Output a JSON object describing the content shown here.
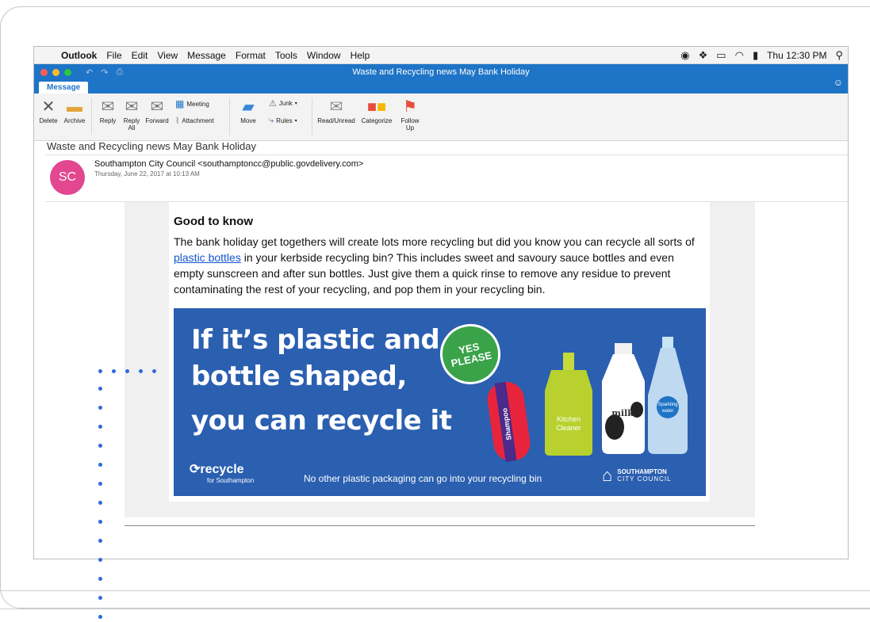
{
  "menubar": {
    "app": "Outlook",
    "items": [
      "File",
      "Edit",
      "View",
      "Message",
      "Format",
      "Tools",
      "Window",
      "Help"
    ],
    "clock": "Thu 12:30 PM"
  },
  "window": {
    "title": "Waste and Recycling news May Bank Holiday"
  },
  "tabs": {
    "message": "Message"
  },
  "ribbon": {
    "delete": "Delete",
    "archive": "Archive",
    "reply": "Reply",
    "reply_all_1": "Reply",
    "reply_all_2": "All",
    "forward": "Forward",
    "meeting": "Meeting",
    "attachment": "Attachment",
    "move": "Move",
    "junk": "Junk",
    "rules": "Rules",
    "read_unread": "Read/Unread",
    "categorize": "Categorize",
    "follow_up_1": "Follow",
    "follow_up_2": "Up"
  },
  "email": {
    "subject": "Waste and Recycling news May Bank Holiday",
    "avatar_initials": "SC",
    "sender": "Southampton City Council <southamptoncc@public.govdelivery.com>",
    "date": "Thursday, June 22, 2017 at 10:13 AM",
    "heading": "Good to know",
    "para_1": "The bank holiday get togethers will create lots more recycling but did you know you can recycle all sorts of ",
    "link": "plastic bottles",
    "para_2": " in your kerbside recycling bin?  This includes sweet and savoury sauce bottles and even empty sunscreen and after sun bottles.  Just give them a quick rinse to remove any residue to prevent contaminating the rest of your recycling, and pop them in your recycling bin."
  },
  "banner": {
    "line_1": "If it’s plastic and",
    "line_2": "bottle shaped,",
    "line_3": "you can recycle it",
    "badge_1": "YES",
    "badge_2": "PLEASE",
    "bottle_1": "Shampoo",
    "bottle_2a": "Kitchen",
    "bottle_2b": "Cleaner",
    "bottle_3": "milk",
    "bottle_4a": "Sparkling",
    "bottle_4b": "water",
    "logo": "recycle",
    "logo_sub": "for Southampton",
    "footer": "No other plastic packaging can go into your recycling bin",
    "council_1": "SOUTHAMPTON",
    "council_2": "CITY COUNCIL"
  },
  "colors": {
    "title_bar": "#1e74c6",
    "avatar": "#e3478f",
    "banner": "#2b5fb0",
    "badge": "#3aa34a",
    "link": "#1155cc",
    "dots": "#2e6bd8"
  }
}
